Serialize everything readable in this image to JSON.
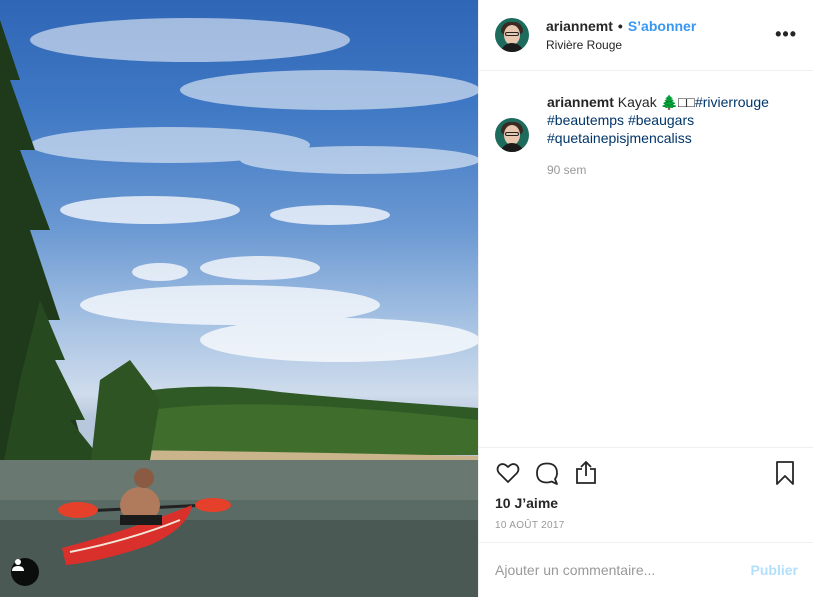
{
  "post": {
    "username": "ariannemt",
    "separator": "•",
    "follow_label": "S’abonner",
    "location": "Rivière Rouge",
    "more_label": "•••"
  },
  "caption": {
    "username": "ariannemt",
    "text": " Kayak 🌲□□",
    "hashtags": [
      "#rivierrouge",
      "#beautemps",
      "#beaugars",
      "#quetainepisjmencaliss"
    ],
    "time": "90 sem"
  },
  "actions": {
    "icons": [
      "heart-icon",
      "comment-icon",
      "share-icon",
      "bookmark-icon"
    ],
    "likes": "10 J’aime",
    "date": "10 AOÛT 2017"
  },
  "comment": {
    "placeholder": "Ajouter un commentaire...",
    "publish_label": "Publier"
  },
  "colors": {
    "follow": "#3897f0",
    "hashtag": "#003569",
    "publish": "#b2dffc"
  }
}
